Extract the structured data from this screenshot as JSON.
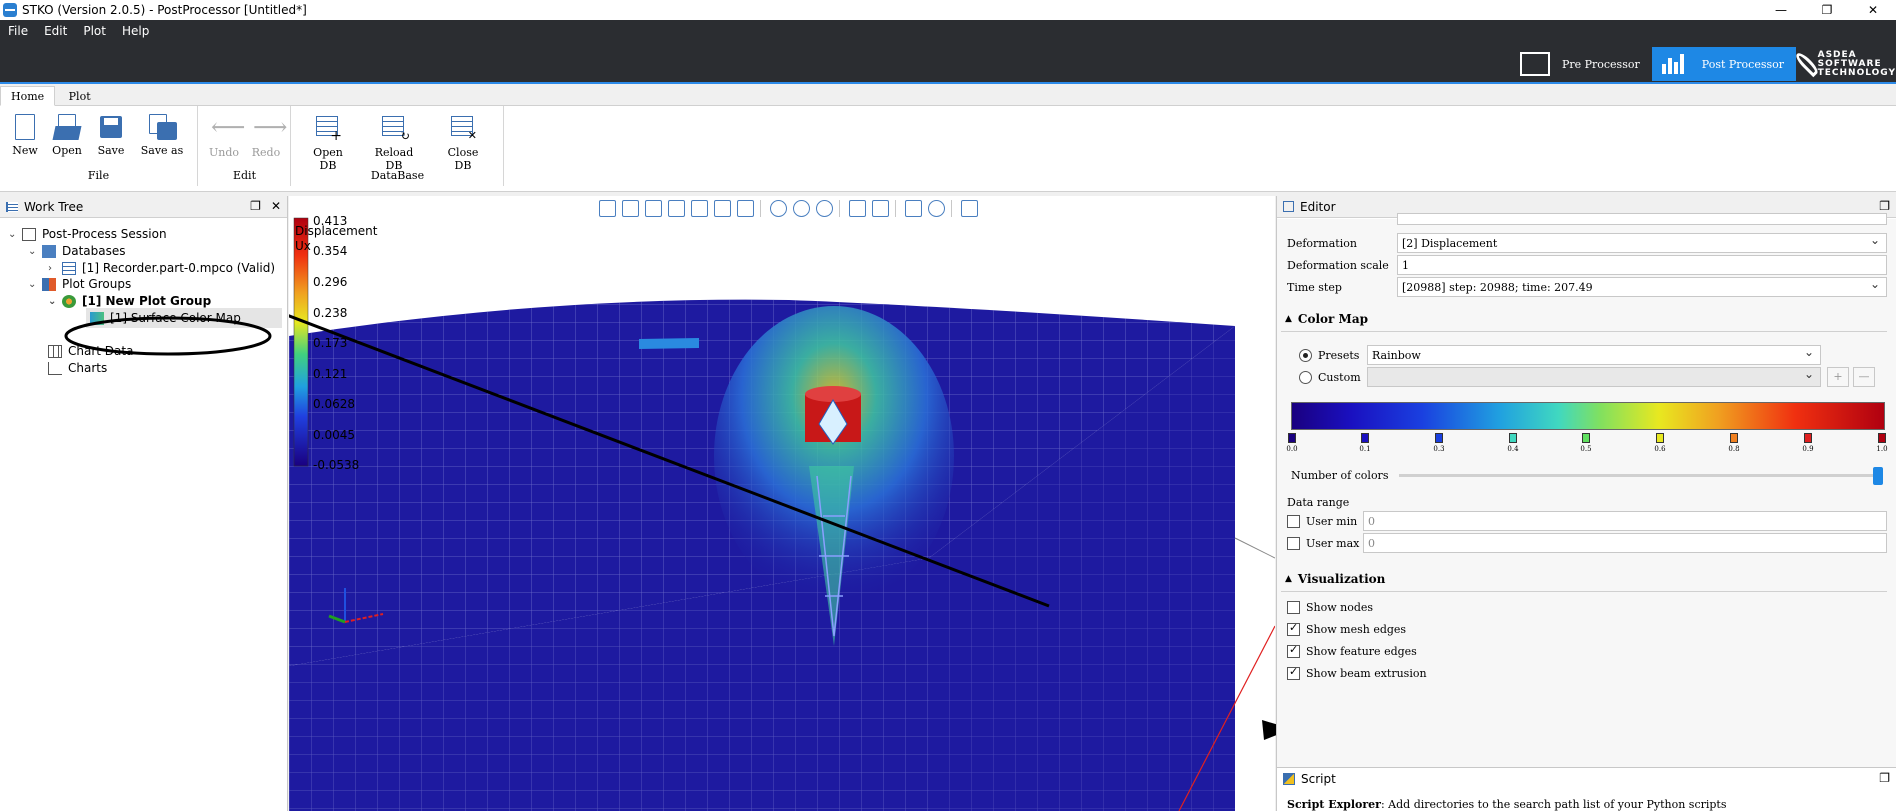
{
  "window": {
    "title": "STKO (Version 2.0.5) - PostProcessor [Untitled*]",
    "minimize": "—",
    "maximize": "❐",
    "close": "✕"
  },
  "menu": [
    "File",
    "Edit",
    "Plot",
    "Help"
  ],
  "perspectives": {
    "pre": "Pre Processor",
    "post": "Post Processor"
  },
  "logo": {
    "line1": "ASDEA",
    "line2": "SOFTWARE",
    "line3": "TECHNOLOGY"
  },
  "ribbon_tabs": [
    "Home",
    "Plot"
  ],
  "ribbon": {
    "file": {
      "name": "File",
      "new": "New",
      "open": "Open",
      "save": "Save",
      "save_as": "Save as"
    },
    "edit": {
      "name": "Edit",
      "undo": "Undo",
      "redo": "Redo"
    },
    "database": {
      "name": "DataBase",
      "open_db": "Open DB",
      "reload_db": "Reload DB",
      "close_db": "Close DB"
    }
  },
  "worktree": {
    "title": "Work Tree",
    "items": [
      "Post-Process Session",
      "Databases",
      "[1] Recorder.part-0.mpco (Valid)",
      "Plot Groups",
      "[1] New Plot Group",
      "[1] Surface Color Map",
      "Chart Data",
      "Charts"
    ]
  },
  "legend": {
    "title": "Displacement",
    "subtitle": "Ux",
    "ticks": [
      "0.413",
      "0.354",
      "0.296",
      "0.238",
      "0.173",
      "0.121",
      "0.0628",
      "0.0045",
      "-0.0538"
    ]
  },
  "editor": {
    "title": "Editor",
    "deformation_label": "Deformation",
    "deformation_value": "[2] Displacement",
    "scale_label": "Deformation scale",
    "scale_value": "1",
    "timestep_label": "Time step",
    "timestep_value": "[20988] step: 20988; time: 207.49",
    "colormap_title": "Color Map",
    "presets_label": "Presets",
    "presets_value": "Rainbow",
    "custom_label": "Custom",
    "stops": [
      "0.0",
      "0.1",
      "0.3",
      "0.4",
      "0.5",
      "0.6",
      "0.8",
      "0.9",
      "1.0"
    ],
    "num_colors_label": "Number of colors",
    "num_colors_fraction": 1.0,
    "data_range_label": "Data range",
    "user_min_label": "User min",
    "user_min_value": "0",
    "user_max_label": "User max",
    "user_max_value": "0",
    "visualization_title": "Visualization",
    "show_nodes": "Show nodes",
    "show_mesh_edges": "Show mesh edges",
    "show_feature_edges": "Show feature edges",
    "show_beam_extrusion": "Show beam extrusion"
  },
  "script": {
    "title": "Script",
    "text_bold": "Script Explorer",
    "text": ": Add directories to the search path list of your Python scripts"
  },
  "colors": {
    "accent": "#1e88e5",
    "header": "#2b2d31",
    "mesh": "#1e1aa0"
  }
}
